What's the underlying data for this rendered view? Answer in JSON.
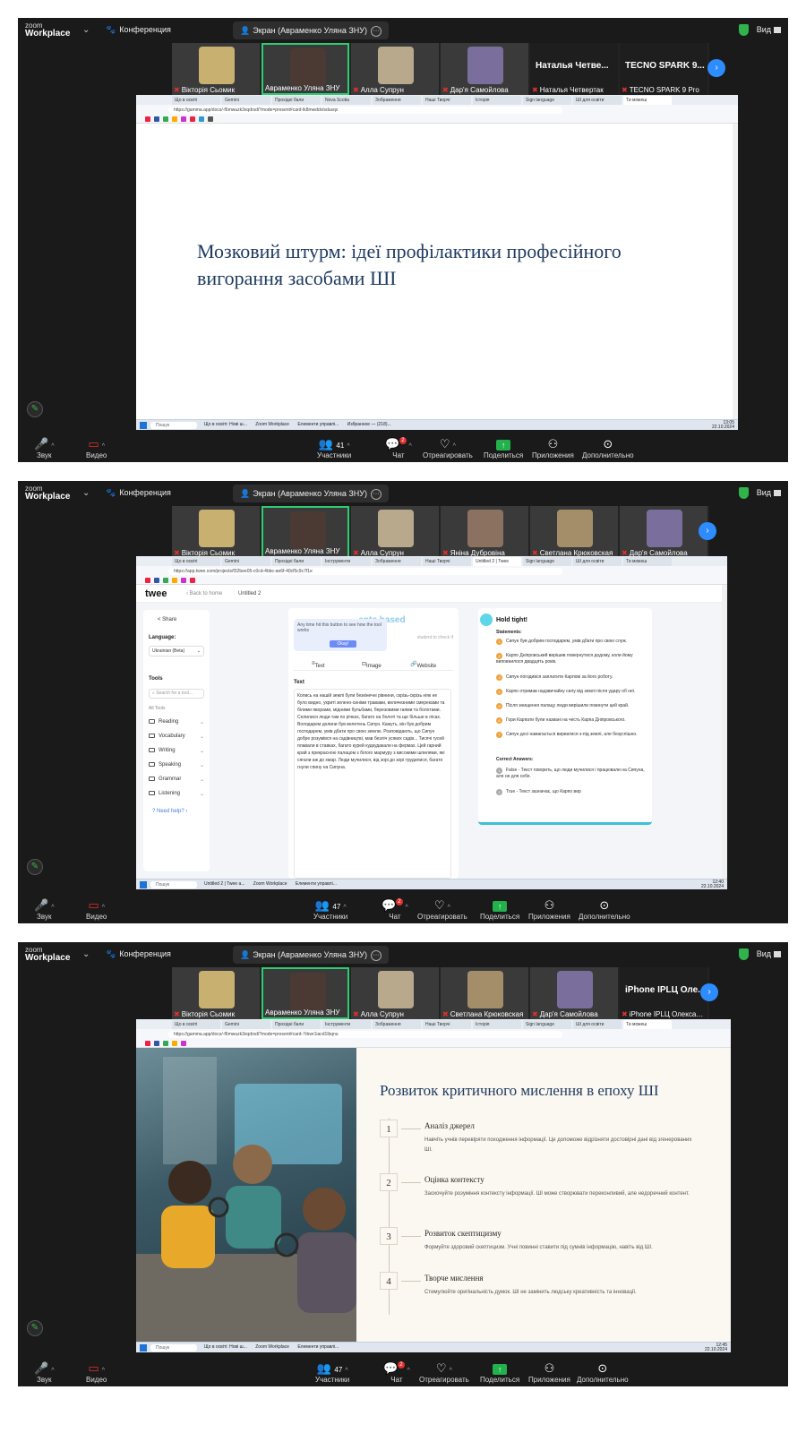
{
  "zoom": {
    "logo_line1": "zoom",
    "logo_line2": "Workplace",
    "conference": "Конференция",
    "screen_share": "Экран (Авраменко Уляна ЗНУ)",
    "view": "Вид",
    "controls": {
      "sound": "Звук",
      "video": "Видео",
      "participants": "Участники",
      "chat": "Чат",
      "chat_badge": "2",
      "react": "Отреагировать",
      "share": "Поделиться",
      "apps": "Приложения",
      "more": "Дополнительно"
    }
  },
  "frames": [
    {
      "participants_count": "41",
      "tiles": [
        "Вікторія Сьомик",
        "Авраменко Уляна ЗНУ",
        "Алла Супрун",
        "Дар'я Самойлова",
        "Наталья Четвертак",
        "TECNO SPARK 9 Pro"
      ],
      "big_labels": [
        "Наталья Четве...",
        "TECNO SPARK 9..."
      ],
      "url": "https://gamma.app/docs/-f6mwuzk3xqdrsdi?mode=present#card-lk8mwddvlsdusqx",
      "slide_title": "Мозковий штурм: ідеї профілактики професійного вигорання засобами ШІ",
      "taskbar_search": "Пошук",
      "taskbar_apps": [
        "Що в освіті: Нові ш...",
        "Zoom Workplace",
        "Елементи управлі...",
        "Избранное — (218)..."
      ],
      "clock": "13:05",
      "date": "22.10.2024"
    },
    {
      "participants_count": "47",
      "tiles": [
        "Вікторія Сьомик",
        "Авраменко Уляна ЗНУ",
        "Алла Супрун",
        "Яніна Дубровіна",
        "Светлана Крюковская",
        "Дар'я Самойлова"
      ],
      "url": "https://app.twee.com/projects/f32bee05-c0cd-4bbc-ae6f-40cf5c9c7f1e",
      "twee": {
        "logo": "twee",
        "back": "Back to home",
        "doc": "Untitled 2",
        "share": "Share",
        "language_label": "Language:",
        "language_value": "Ukrainian (Beta)",
        "tools_label": "Tools",
        "search_placeholder": "Search for a tool...",
        "all_tools": "All Tools",
        "categories": [
          "Reading",
          "Vocabulary",
          "Writing",
          "Speaking",
          "Grammar",
          "Listening"
        ],
        "need_help": "Need help?",
        "editor_title": "...ents based",
        "tip": "Any time hit this button to see how the tool works",
        "tip_ok": "Okay!",
        "hint": "student to check if",
        "tab_text": "Text",
        "tab_image": "Image",
        "tab_website": "Website",
        "text_label": "Text",
        "text_body": "Колись на нашій землі були безкінечні рівнини, скрізь-скрізь ніяк не було видно, укриті зелено-синіми травами, величезними смереками та білими яворами, мідними бульбами, березовими гаями та болотами. Селилися люди там по річках, багато на болоті та ще більше в лісах. Володарем долини був велетень Сипун. Кажуть, він був добрим господарем, умів дбати про свою землю. Розповідають, що Сипун добре розумівся на садівництві, мав безліч усяких садів... Тисячі гусей плавали в ставках, багато курей кудкудакали на фермах. Цей гарний край з прекрасною палацом з білого мармуру з високими шпилями, які сягали аж до хмар. Люди мучилися, від зорі до зорі трудилися, багато гнули спину на Сипуна.",
        "result_title": "Hold tight!",
        "statements_label": "Statements:",
        "statements": [
          "Сипун був добрим господарем, умів дбати про свою служ.",
          "Карпо Дніпровський вирішив повернутися додому, коли йому виповнилося двадцять років.",
          "Сипун погодився заплатити Карпові за його роботу.",
          "Карпо отримав надзвичайну силу від землі після удару об неї.",
          "Після знищення палацу люди вирішили покинути цей край.",
          "Гори Карпати були названі на честь Карпа Дніпровського.",
          "Сипун досі намагається вирватися з-під землі, але безуспішно."
        ],
        "correct_label": "Correct Answers:",
        "answers": [
          "False - Текст говорить, що люди мучилися і працювали на Сипуна, але не для себе.",
          "True - Текст зазначає, що Карпо вир"
        ]
      },
      "taskbar_search": "Пошук",
      "taskbar_apps": [
        "Untitled 2 | Twee a...",
        "Zoom Workplace",
        "Елементи управлі..."
      ],
      "clock": "12:40",
      "date": "22.10.2024"
    },
    {
      "participants_count": "47",
      "tiles": [
        "Вікторія Сьомик",
        "Авраменко Уляна ЗНУ",
        "Алла Супрун",
        "Светлана Крюковская",
        "Дар'я Самойлова",
        "iPhone IPLЦ Олександр..."
      ],
      "big_labels": [
        "iPhone IPLЦ Оле..."
      ],
      "url": "https://gamma.app/docs/-f6mwuzk3xqdrsdi?mode=present#card-7rbwr1iacd1lbqnu",
      "slide_title": "Розвиток критичного мислення в епоху ШІ",
      "steps": [
        {
          "num": "1",
          "title": "Аналіз джерел",
          "text": "Навчіть учнів перевіряти походження інформації. Це допоможе відрізняти достовірні дані від згенерованих ШІ."
        },
        {
          "num": "2",
          "title": "Оцінка контексту",
          "text": "Заохочуйте розуміння контексту інформації. ШІ може створювати переконливий, але недоречний контент."
        },
        {
          "num": "3",
          "title": "Розвиток скептицизму",
          "text": "Формуйте здоровий скептицизм. Учні повинні ставити під сумнів інформацію, навіть від ШІ."
        },
        {
          "num": "4",
          "title": "Творче мислення",
          "text": "Стимулюйте оригінальність думок. ШІ не замінить людську креативність та інновації."
        }
      ],
      "taskbar_search": "Пошук",
      "taskbar_apps": [
        "Що в освіті: Нові ш...",
        "Zoom Workplace",
        "Елементи управлі..."
      ],
      "clock": "12:45",
      "date": "22.10.2024"
    }
  ]
}
